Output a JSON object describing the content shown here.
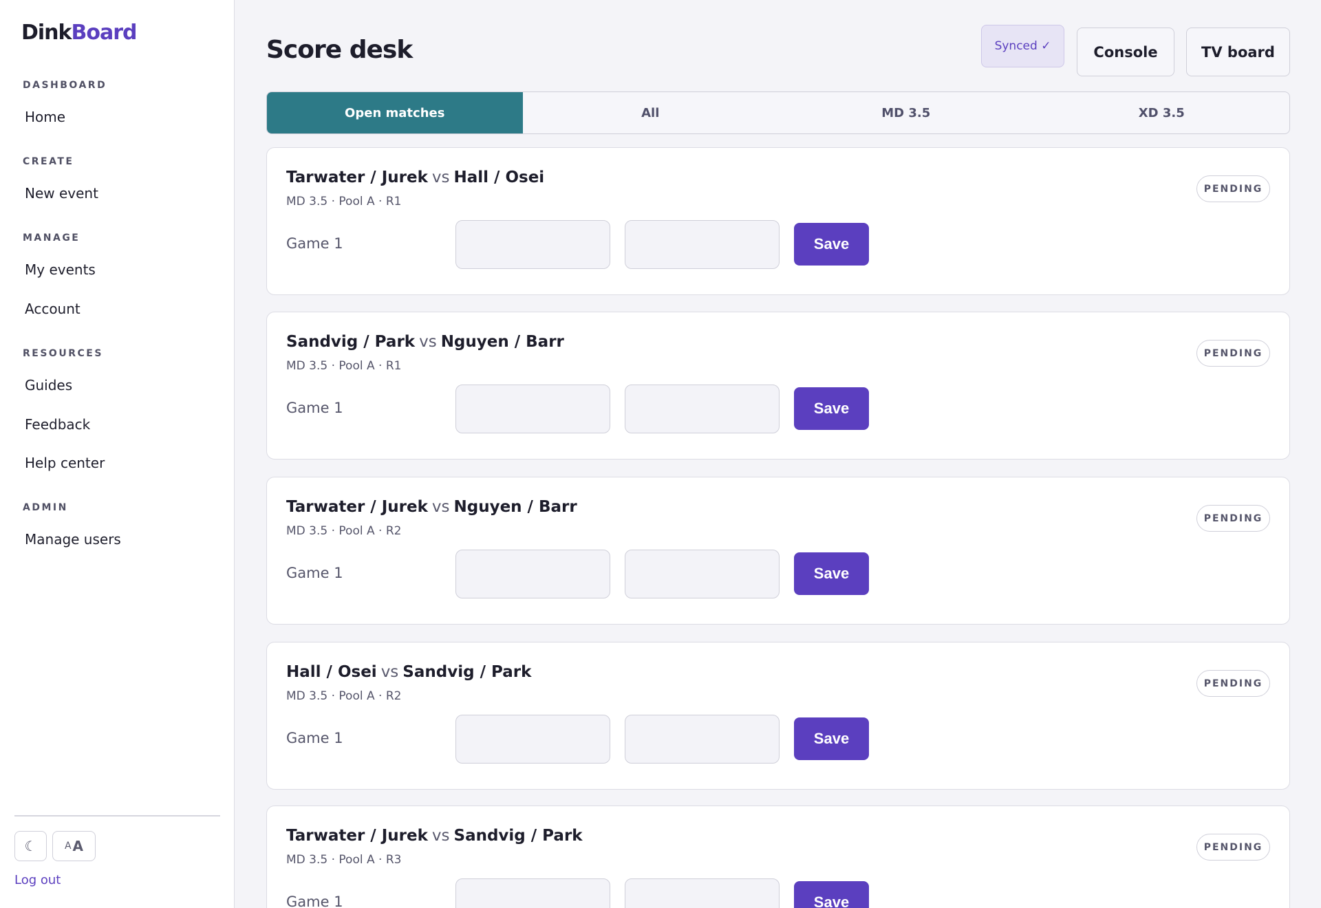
{
  "brand": {
    "part1": "Dink",
    "part2": "Board"
  },
  "sidebar": {
    "sections": [
      {
        "title": "DASHBOARD",
        "items": [
          "Home"
        ]
      },
      {
        "title": "CREATE",
        "items": [
          "New event"
        ]
      },
      {
        "title": "MANAGE",
        "items": [
          "My events",
          "Account"
        ]
      },
      {
        "title": "RESOURCES",
        "items": [
          "Guides",
          "Feedback",
          "Help center"
        ]
      },
      {
        "title": "ADMIN",
        "items": [
          "Manage users"
        ]
      }
    ],
    "theme_icon": "moon-icon",
    "theme_glyph": "☾",
    "text_size_small": "A",
    "text_size_large": "A",
    "logout_label": "Log out"
  },
  "header": {
    "title": "Score desk",
    "synced_label": "Synced ✓",
    "console_label": "Console",
    "tv_board_label": "TV board"
  },
  "tabs": [
    {
      "label": "Open matches",
      "active": true
    },
    {
      "label": "All",
      "active": false
    },
    {
      "label": "MD 3.5",
      "active": false
    },
    {
      "label": "XD 3.5",
      "active": false
    }
  ],
  "matches": [
    {
      "team1": "Tarwater / Jurek",
      "vs": "vs",
      "team2": "Hall / Osei",
      "meta": "MD 3.5 · Pool A · R1",
      "status": "PENDING",
      "game_label": "Game 1",
      "score1": "",
      "score2": "",
      "save_label": "Save"
    },
    {
      "team1": "Sandvig / Park",
      "vs": "vs",
      "team2": "Nguyen / Barr",
      "meta": "MD 3.5 · Pool A · R1",
      "status": "PENDING",
      "game_label": "Game 1",
      "score1": "",
      "score2": "",
      "save_label": "Save"
    },
    {
      "team1": "Tarwater / Jurek",
      "vs": "vs",
      "team2": "Nguyen / Barr",
      "meta": "MD 3.5 · Pool A · R2",
      "status": "PENDING",
      "game_label": "Game 1",
      "score1": "",
      "score2": "",
      "save_label": "Save"
    },
    {
      "team1": "Hall / Osei",
      "vs": "vs",
      "team2": "Sandvig / Park",
      "meta": "MD 3.5 · Pool A · R2",
      "status": "PENDING",
      "game_label": "Game 1",
      "score1": "",
      "score2": "",
      "save_label": "Save"
    },
    {
      "team1": "Tarwater / Jurek",
      "vs": "vs",
      "team2": "Sandvig / Park",
      "meta": "MD 3.5 · Pool A · R3",
      "status": "PENDING",
      "game_label": "Game 1",
      "score1": "",
      "score2": "",
      "save_label": "Save"
    }
  ],
  "colors": {
    "brand_accent": "#5b3fbf",
    "active_tab": "#2d7a87",
    "save_button": "#5b3fbf"
  }
}
